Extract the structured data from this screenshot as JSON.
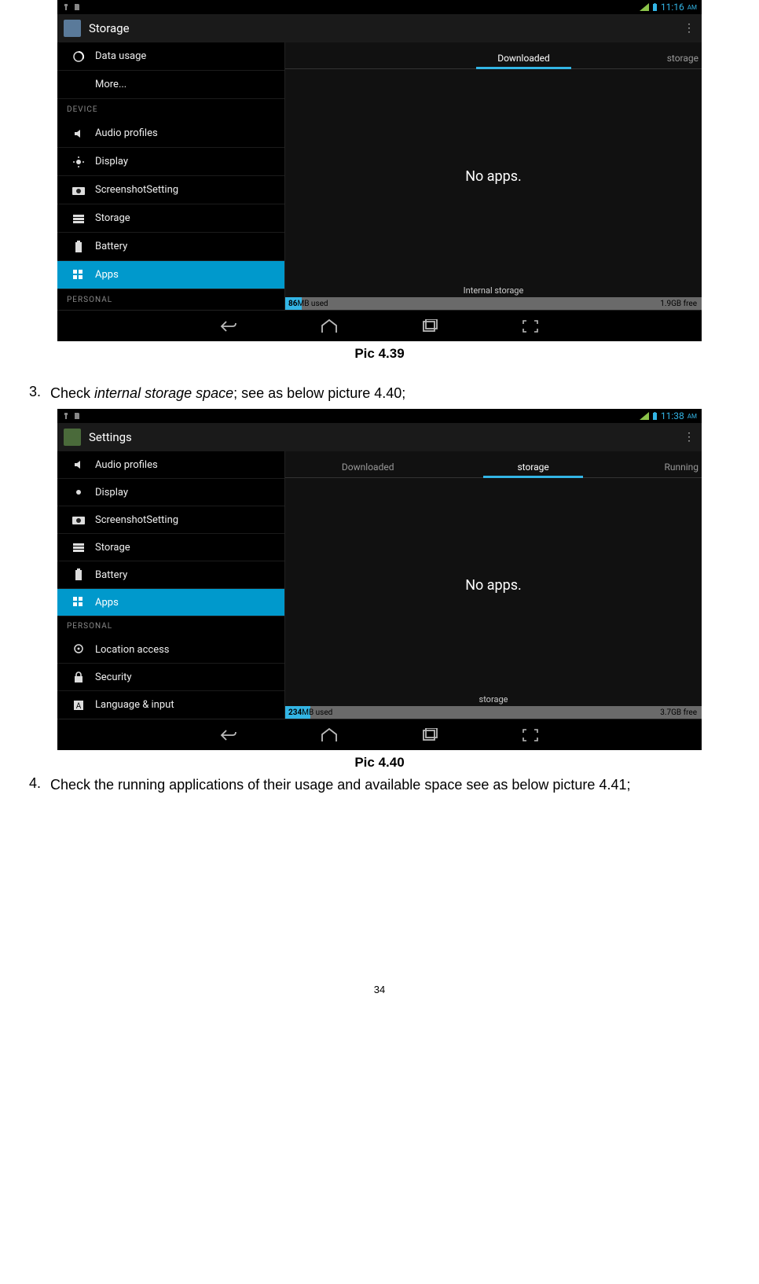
{
  "page_number": "34",
  "shot1": {
    "status_time": "11:16",
    "status_ampm": "AM",
    "appbar_title": "Storage",
    "sidebar": {
      "hdr_device": "DEVICE",
      "hdr_personal": "PERSONAL",
      "items": {
        "data_usage": "Data usage",
        "more": "More...",
        "audio": "Audio profiles",
        "display": "Display",
        "screenshot": "ScreenshotSetting",
        "storage": "Storage",
        "battery": "Battery",
        "apps": "Apps"
      }
    },
    "tabs": {
      "downloaded": "Downloaded",
      "storage": "storage"
    },
    "noapps": "No apps.",
    "foot_title": "Internal storage",
    "foot_used_val": "86",
    "foot_used_unit": "MB used",
    "foot_free": "1.9GB free",
    "fill_pct": 4
  },
  "cap1": "Pic 4.39",
  "step3_num": "3.",
  "step3_a": "Check ",
  "step3_b": "internal storage space",
  "step3_c": "; see as below picture 4.40;",
  "shot2": {
    "status_time": "11:38",
    "status_ampm": "AM",
    "appbar_title": "Settings",
    "sidebar": {
      "hdr_personal": "PERSONAL",
      "items": {
        "audio": "Audio profiles",
        "display": "Display",
        "screenshot": "ScreenshotSetting",
        "storage": "Storage",
        "battery": "Battery",
        "apps": "Apps",
        "location": "Location access",
        "security": "Security",
        "lang": "Language & input"
      }
    },
    "tabs": {
      "downloaded": "Downloaded",
      "storage": "storage",
      "running": "Running"
    },
    "noapps": "No apps.",
    "foot_title": "storage",
    "foot_used_val": "234",
    "foot_used_unit": "MB used",
    "foot_free": "3.7GB free",
    "fill_pct": 6
  },
  "cap2": "Pic 4.40",
  "step4_num": "4.",
  "step4_text": "Check the running applications of their usage and available space see as below picture 4.41;"
}
